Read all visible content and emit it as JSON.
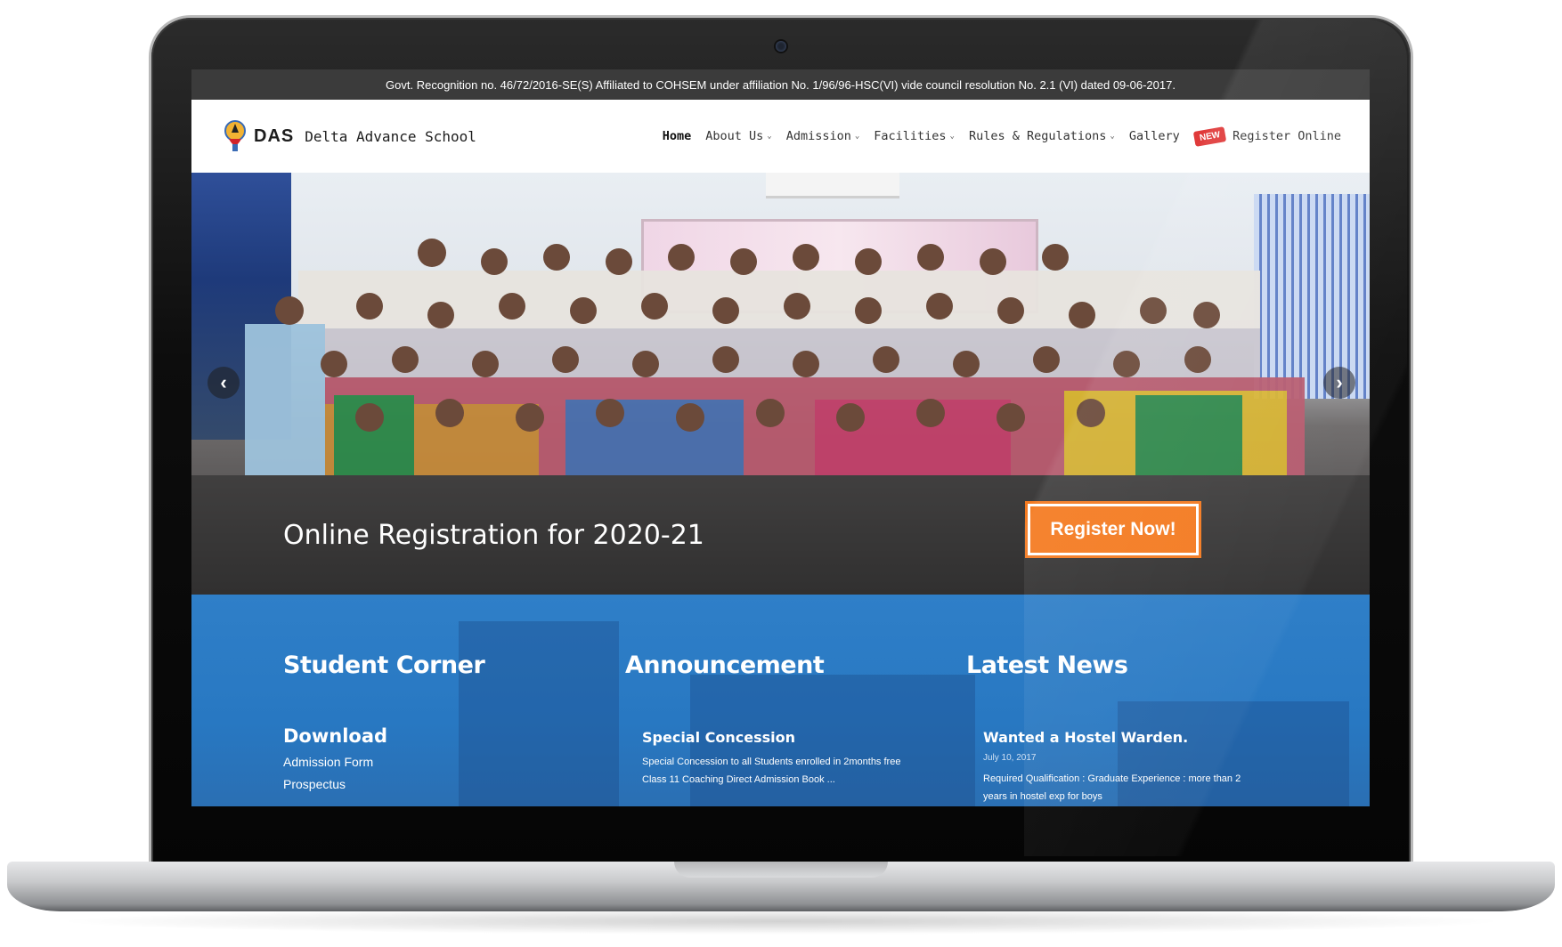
{
  "topbar": {
    "notice": "Govt. Recognition no. 46/72/2016-SE(S) Affiliated to COHSEM under affiliation No. 1/96/96-HSC(VI) vide council resolution No. 2.1 (VI) dated 09-06-2017."
  },
  "logo": {
    "abbr": "DAS",
    "name": "Delta Advance School"
  },
  "nav": {
    "items": [
      {
        "label": "Home",
        "active": true,
        "dropdown": false
      },
      {
        "label": "About Us",
        "dropdown": true
      },
      {
        "label": "Admission",
        "dropdown": true
      },
      {
        "label": "Facilities",
        "dropdown": true
      },
      {
        "label": "Rules & Regulations",
        "dropdown": true
      },
      {
        "label": "Gallery",
        "dropdown": false
      },
      {
        "label": "Register Online",
        "badge": "NEW",
        "dropdown": false
      }
    ]
  },
  "hero": {
    "caption": "Online Registration for 2020-21",
    "cta_label": "Register Now!",
    "prev_icon": "chevron-left-icon",
    "next_icon": "chevron-right-icon"
  },
  "student_corner": {
    "title": "Student Corner",
    "download_heading": "Download",
    "links": [
      "Admission Form",
      "Prospectus"
    ]
  },
  "announcement": {
    "title": "Announcement",
    "item_title": "Special Concession",
    "item_text": "Special Concession to all Students enrolled in 2months free Class 11 Coaching Direct Admission Book ..."
  },
  "latest_news": {
    "title": "Latest News",
    "item_title": "Wanted a Hostel Warden.",
    "item_date": "July 10, 2017",
    "item_text": "Required Qualification : Graduate Experience : more than 2 years in hostel exp for boys"
  },
  "colors": {
    "accent_orange": "#f47a20",
    "section_blue": "#2878c2",
    "topbar_dark": "#3b3b3b",
    "badge_red": "#e03a3a"
  }
}
